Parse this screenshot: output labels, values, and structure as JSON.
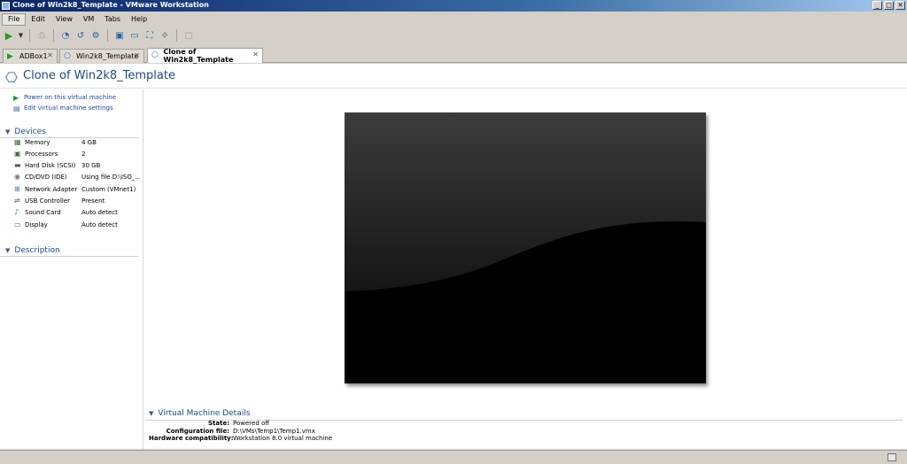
{
  "window": {
    "title": "Clone of Win2k8_Template - VMware Workstation",
    "minimize": "_",
    "maximize": "□",
    "close": "✕"
  },
  "menu": [
    "File",
    "Edit",
    "View",
    "VM",
    "Tabs",
    "Help"
  ],
  "toolbar": {
    "icons": [
      "play-icon",
      "dropdown-icon",
      "suspend-icon",
      "snapshot-icon",
      "revert-snapshot-icon",
      "snapshot-manager-icon",
      "console-view-icon",
      "quick-switch-icon",
      "full-screen-icon",
      "unity-icon",
      "thumbnail-icon"
    ]
  },
  "tabs": [
    {
      "label": "ADBox1",
      "close": "✕"
    },
    {
      "label": "Win2k8_Template",
      "close": "✕"
    },
    {
      "label": "Clone of Win2k8_Template",
      "close": "✕"
    }
  ],
  "vm": {
    "title": "Clone of Win2k8_Template",
    "actions": {
      "power_on": "Power on this virtual machine",
      "edit_settings": "Edit virtual machine settings"
    },
    "sections": {
      "devices": "Devices",
      "description": "Description"
    },
    "devices": [
      {
        "name": "Memory",
        "value": "4 GB",
        "icon": "memory-icon"
      },
      {
        "name": "Processors",
        "value": "2",
        "icon": "processor-icon"
      },
      {
        "name": "Hard Disk (SCSI)",
        "value": "30 GB",
        "icon": "hard-disk-icon"
      },
      {
        "name": "CD/DVD (IDE)",
        "value": "Using file D:\\ISO_...",
        "icon": "cd-dvd-icon"
      },
      {
        "name": "Network Adapter",
        "value": "Custom (VMnet1)",
        "icon": "network-adapter-icon"
      },
      {
        "name": "USB Controller",
        "value": "Present",
        "icon": "usb-icon"
      },
      {
        "name": "Sound Card",
        "value": "Auto detect",
        "icon": "sound-card-icon"
      },
      {
        "name": "Display",
        "value": "Auto detect",
        "icon": "display-icon"
      }
    ],
    "details": {
      "heading": "Virtual Machine Details",
      "state_label": "State:",
      "state": "Powered off",
      "config_label": "Configuration file:",
      "config": "D:\\VMs\\Temp1\\Temp1.vmx",
      "compat_label": "Hardware compatibility:",
      "compat": "Workstation 8.0 virtual machine"
    }
  },
  "colors": {
    "link": "#1a4a9a",
    "heading": "#1a4a8a",
    "play": "#2a9a2a"
  }
}
